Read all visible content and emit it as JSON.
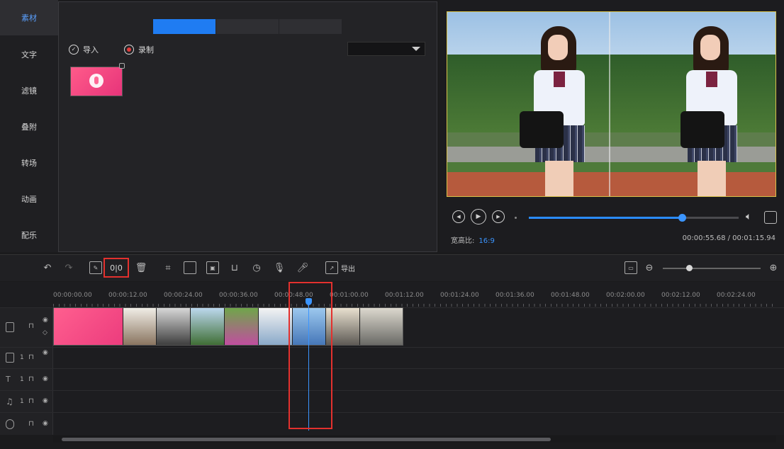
{
  "app_title": "",
  "sidebar": {
    "items": [
      {
        "label": "素材",
        "active": true
      },
      {
        "label": "文字",
        "active": false
      },
      {
        "label": "滤镜",
        "active": false
      },
      {
        "label": "叠附",
        "active": false
      },
      {
        "label": "转场",
        "active": false
      },
      {
        "label": "动画",
        "active": false
      },
      {
        "label": "配乐",
        "active": false
      }
    ]
  },
  "media": {
    "tabs": [
      "",
      "",
      ""
    ],
    "import_label": "导入",
    "record_label": "录制",
    "filter_value": "",
    "item_name": ""
  },
  "preview": {
    "subtitle": "",
    "ratio_label": "宽高比:",
    "ratio_value": "16:9",
    "timecode": "00:00:55.68 / 00:01:15.94",
    "progress": 0.73
  },
  "toolbar": {
    "split_label": "0|0",
    "export_label": "导出",
    "zoom": 0.27
  },
  "ruler": {
    "ticks": [
      "00:00:00.00",
      "00:00:12.00",
      "00:00:24.00",
      "00:00:36.00",
      "00:00:48.00",
      "00:01:00.00",
      "00:01:12.00",
      "00:01:24.00",
      "00:01:36.00",
      "00:01:48.00",
      "00:02:00.00",
      "00:02:12.00",
      "00:02:24.00"
    ]
  },
  "timeline": {
    "title_clip_text": "",
    "track_numbers": [
      "1",
      "1",
      "1"
    ]
  },
  "colors": {
    "accent": "#1f7cf2",
    "highlight": "#e3312e",
    "clip_pink": "#ec3c7d"
  }
}
